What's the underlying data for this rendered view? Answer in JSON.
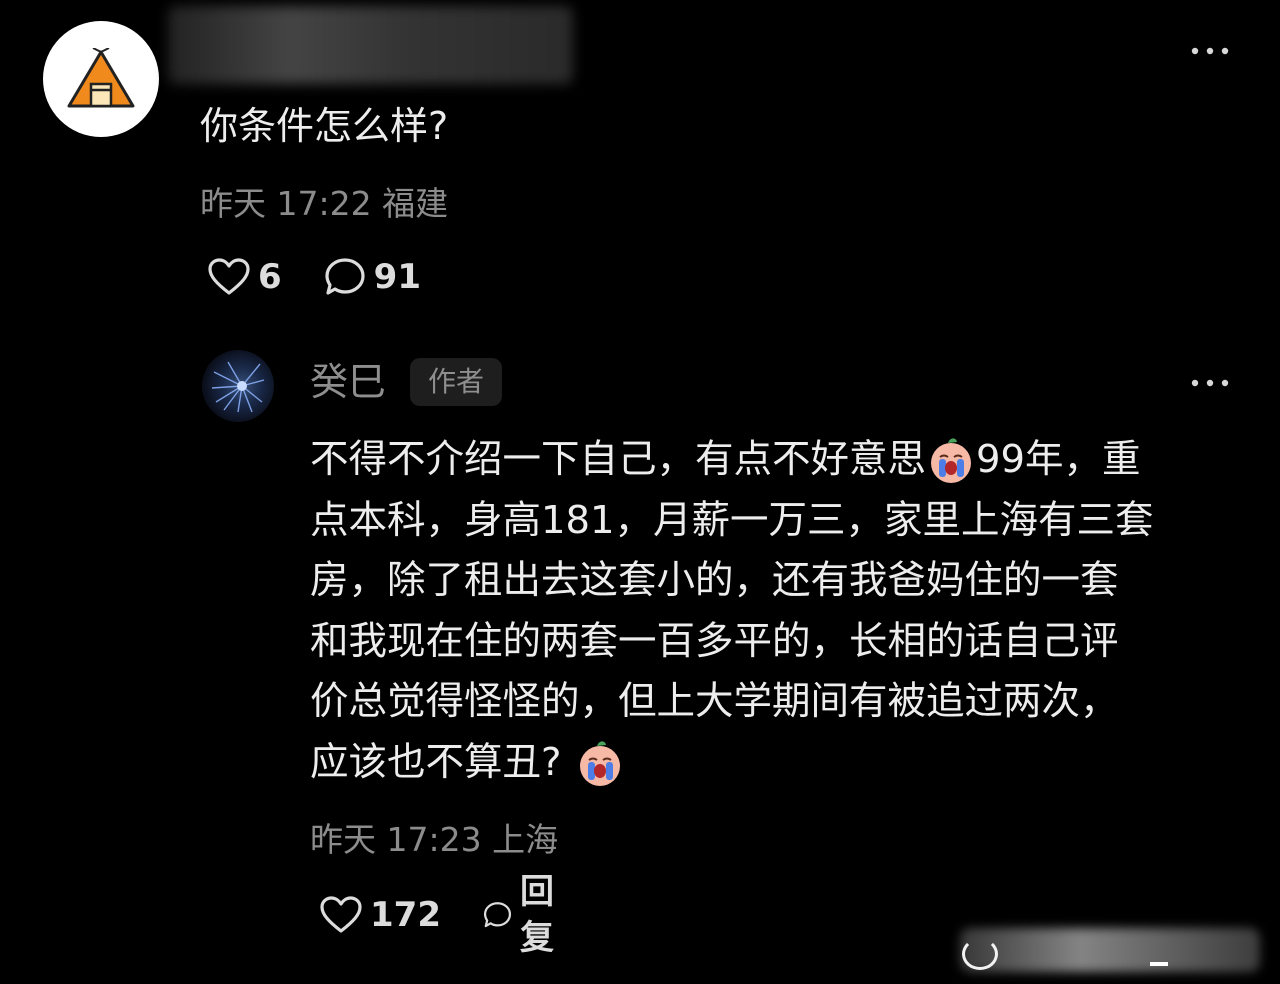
{
  "top_comment": {
    "avatar_icon": "tent-icon",
    "username": "",
    "text": "你条件怎么样?",
    "time": "昨天 17:22",
    "location": "福建",
    "likes": "6",
    "replies": "91",
    "more_icon": "more-dots-icon",
    "accent_color": "#f08a1c"
  },
  "reply_comment": {
    "username": "癸巳",
    "badge": "作者",
    "avatar_icon": "dark-blue-abstract-avatar",
    "lines": [
      "不得不介绍一下自己，有点不好意思",
      "99年，重",
      "点本科，身高181，月薪一万三，家里上海有三套",
      "房，除了租出去这套小的，还有我爸妈住的一套",
      "和我现在住的两套一百多平的，长相的话自己评",
      "价总觉得怪怪的，但上大学期间有被追过两次，",
      "应该也不算丑?"
    ],
    "emoji_icon": "crying-face-emoji",
    "time": "昨天 17:23",
    "location": "上海",
    "likes": "172",
    "reply_label": "回复",
    "more_icon": "more-dots-icon"
  },
  "icons": {
    "like": "heart-outline-icon",
    "comment": "speech-bubble-icon"
  },
  "colors": {
    "background": "#000000",
    "text": "#ededed",
    "meta_text": "#8c8c8c"
  }
}
